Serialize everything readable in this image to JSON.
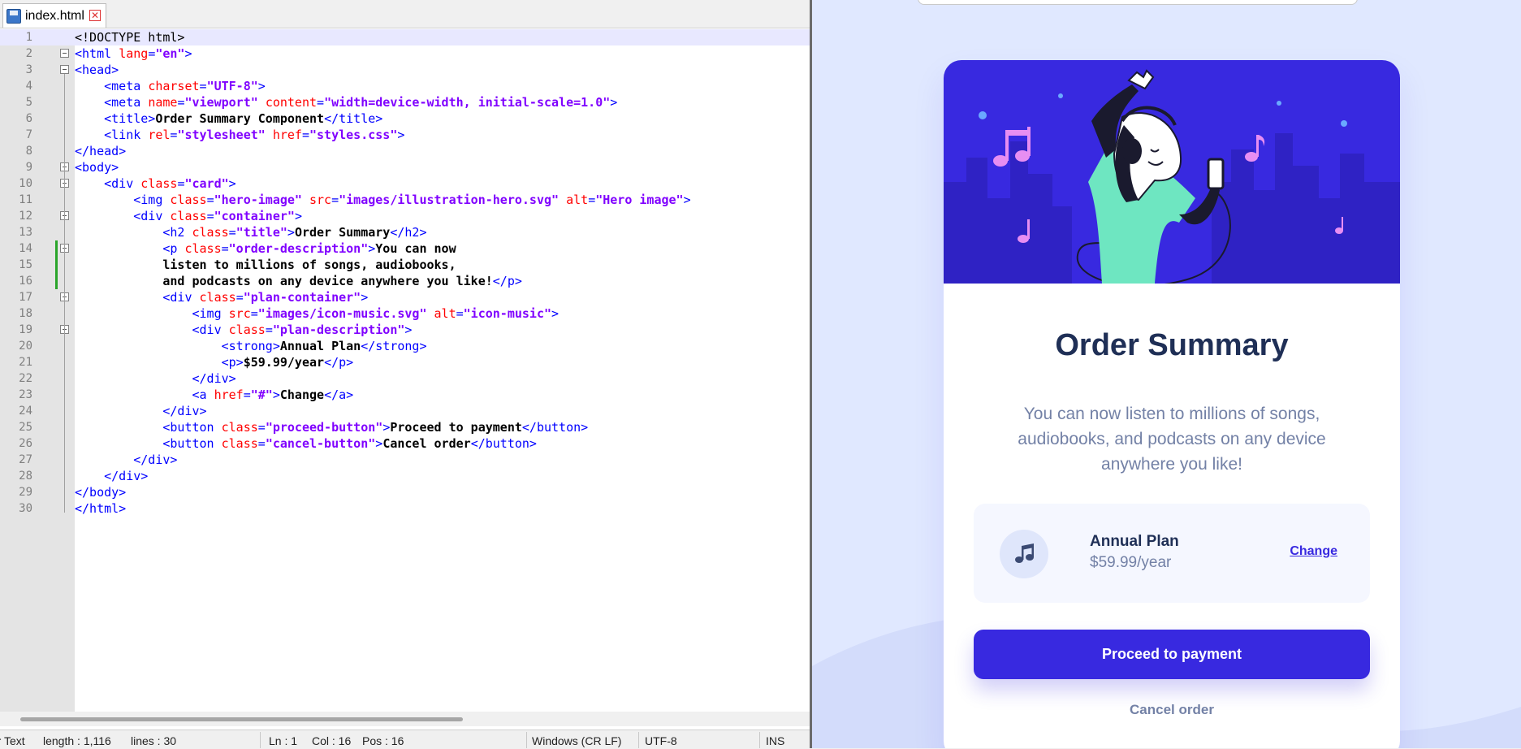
{
  "editor": {
    "tab_label": "index.html",
    "lines": [
      [
        {
          "c": "doc",
          "t": "<!DOCTYPE html>"
        }
      ],
      [
        {
          "c": "tag",
          "t": "<html "
        },
        {
          "c": "attr",
          "t": "lang"
        },
        {
          "c": "tag",
          "t": "="
        },
        {
          "c": "val",
          "t": "\"en\""
        },
        {
          "c": "tag",
          "t": ">"
        }
      ],
      [
        {
          "c": "tag",
          "t": "<head>"
        }
      ],
      [
        {
          "c": "doc",
          "t": "    "
        },
        {
          "c": "tag",
          "t": "<meta "
        },
        {
          "c": "attr",
          "t": "charset"
        },
        {
          "c": "tag",
          "t": "="
        },
        {
          "c": "val",
          "t": "\"UTF-8\""
        },
        {
          "c": "tag",
          "t": ">"
        }
      ],
      [
        {
          "c": "doc",
          "t": "    "
        },
        {
          "c": "tag",
          "t": "<meta "
        },
        {
          "c": "attr",
          "t": "name"
        },
        {
          "c": "tag",
          "t": "="
        },
        {
          "c": "val",
          "t": "\"viewport\""
        },
        {
          "c": "doc",
          "t": " "
        },
        {
          "c": "attr",
          "t": "content"
        },
        {
          "c": "tag",
          "t": "="
        },
        {
          "c": "val",
          "t": "\"width=device-width, initial-scale=1.0\""
        },
        {
          "c": "tag",
          "t": ">"
        }
      ],
      [
        {
          "c": "doc",
          "t": "    "
        },
        {
          "c": "tag",
          "t": "<title>"
        },
        {
          "c": "text",
          "t": "Order Summary Component"
        },
        {
          "c": "tag",
          "t": "</title>"
        }
      ],
      [
        {
          "c": "doc",
          "t": "    "
        },
        {
          "c": "tag",
          "t": "<link "
        },
        {
          "c": "attr",
          "t": "rel"
        },
        {
          "c": "tag",
          "t": "="
        },
        {
          "c": "val",
          "t": "\"stylesheet\""
        },
        {
          "c": "doc",
          "t": " "
        },
        {
          "c": "attr",
          "t": "href"
        },
        {
          "c": "tag",
          "t": "="
        },
        {
          "c": "val",
          "t": "\"styles.css\""
        },
        {
          "c": "tag",
          "t": ">"
        }
      ],
      [
        {
          "c": "tag",
          "t": "</head>"
        }
      ],
      [
        {
          "c": "tag",
          "t": "<body>"
        }
      ],
      [
        {
          "c": "doc",
          "t": "    "
        },
        {
          "c": "tag",
          "t": "<div "
        },
        {
          "c": "attr",
          "t": "class"
        },
        {
          "c": "tag",
          "t": "="
        },
        {
          "c": "val",
          "t": "\"card\""
        },
        {
          "c": "tag",
          "t": ">"
        }
      ],
      [
        {
          "c": "doc",
          "t": "        "
        },
        {
          "c": "tag",
          "t": "<img "
        },
        {
          "c": "attr",
          "t": "class"
        },
        {
          "c": "tag",
          "t": "="
        },
        {
          "c": "val",
          "t": "\"hero-image\""
        },
        {
          "c": "doc",
          "t": " "
        },
        {
          "c": "attr",
          "t": "src"
        },
        {
          "c": "tag",
          "t": "="
        },
        {
          "c": "val",
          "t": "\"images/illustration-hero.svg\""
        },
        {
          "c": "doc",
          "t": " "
        },
        {
          "c": "attr",
          "t": "alt"
        },
        {
          "c": "tag",
          "t": "="
        },
        {
          "c": "val",
          "t": "\"Hero image\""
        },
        {
          "c": "tag",
          "t": ">"
        }
      ],
      [
        {
          "c": "doc",
          "t": "        "
        },
        {
          "c": "tag",
          "t": "<div "
        },
        {
          "c": "attr",
          "t": "class"
        },
        {
          "c": "tag",
          "t": "="
        },
        {
          "c": "val",
          "t": "\"container\""
        },
        {
          "c": "tag",
          "t": ">"
        }
      ],
      [
        {
          "c": "doc",
          "t": "            "
        },
        {
          "c": "tag",
          "t": "<h2 "
        },
        {
          "c": "attr",
          "t": "class"
        },
        {
          "c": "tag",
          "t": "="
        },
        {
          "c": "val",
          "t": "\"title\""
        },
        {
          "c": "tag",
          "t": ">"
        },
        {
          "c": "text",
          "t": "Order Summary"
        },
        {
          "c": "tag",
          "t": "</h2>"
        }
      ],
      [
        {
          "c": "doc",
          "t": "            "
        },
        {
          "c": "tag",
          "t": "<p "
        },
        {
          "c": "attr",
          "t": "class"
        },
        {
          "c": "tag",
          "t": "="
        },
        {
          "c": "val",
          "t": "\"order-description\""
        },
        {
          "c": "tag",
          "t": ">"
        },
        {
          "c": "text",
          "t": "You can now"
        }
      ],
      [
        {
          "c": "text",
          "t": "            listen to millions of songs, audiobooks,"
        }
      ],
      [
        {
          "c": "text",
          "t": "            and podcasts on any device anywhere you like!"
        },
        {
          "c": "tag",
          "t": "</p>"
        }
      ],
      [
        {
          "c": "doc",
          "t": "            "
        },
        {
          "c": "tag",
          "t": "<div "
        },
        {
          "c": "attr",
          "t": "class"
        },
        {
          "c": "tag",
          "t": "="
        },
        {
          "c": "val",
          "t": "\"plan-container\""
        },
        {
          "c": "tag",
          "t": ">"
        }
      ],
      [
        {
          "c": "doc",
          "t": "                "
        },
        {
          "c": "tag",
          "t": "<img "
        },
        {
          "c": "attr",
          "t": "src"
        },
        {
          "c": "tag",
          "t": "="
        },
        {
          "c": "val",
          "t": "\"images/icon-music.svg\""
        },
        {
          "c": "doc",
          "t": " "
        },
        {
          "c": "attr",
          "t": "alt"
        },
        {
          "c": "tag",
          "t": "="
        },
        {
          "c": "val",
          "t": "\"icon-music\""
        },
        {
          "c": "tag",
          "t": ">"
        }
      ],
      [
        {
          "c": "doc",
          "t": "                "
        },
        {
          "c": "tag",
          "t": "<div "
        },
        {
          "c": "attr",
          "t": "class"
        },
        {
          "c": "tag",
          "t": "="
        },
        {
          "c": "val",
          "t": "\"plan-description\""
        },
        {
          "c": "tag",
          "t": ">"
        }
      ],
      [
        {
          "c": "doc",
          "t": "                    "
        },
        {
          "c": "tag",
          "t": "<strong>"
        },
        {
          "c": "text",
          "t": "Annual Plan"
        },
        {
          "c": "tag",
          "t": "</strong>"
        }
      ],
      [
        {
          "c": "doc",
          "t": "                    "
        },
        {
          "c": "tag",
          "t": "<p>"
        },
        {
          "c": "text",
          "t": "$59.99/year"
        },
        {
          "c": "tag",
          "t": "</p>"
        }
      ],
      [
        {
          "c": "doc",
          "t": "                "
        },
        {
          "c": "tag",
          "t": "</div>"
        }
      ],
      [
        {
          "c": "doc",
          "t": "                "
        },
        {
          "c": "tag",
          "t": "<a "
        },
        {
          "c": "attr",
          "t": "href"
        },
        {
          "c": "tag",
          "t": "="
        },
        {
          "c": "val",
          "t": "\"#\""
        },
        {
          "c": "tag",
          "t": ">"
        },
        {
          "c": "text",
          "t": "Change"
        },
        {
          "c": "tag",
          "t": "</a>"
        }
      ],
      [
        {
          "c": "doc",
          "t": "            "
        },
        {
          "c": "tag",
          "t": "</div>"
        }
      ],
      [
        {
          "c": "doc",
          "t": "            "
        },
        {
          "c": "tag",
          "t": "<button "
        },
        {
          "c": "attr",
          "t": "class"
        },
        {
          "c": "tag",
          "t": "="
        },
        {
          "c": "val",
          "t": "\"proceed-button\""
        },
        {
          "c": "tag",
          "t": ">"
        },
        {
          "c": "text",
          "t": "Proceed to payment"
        },
        {
          "c": "tag",
          "t": "</button>"
        }
      ],
      [
        {
          "c": "doc",
          "t": "            "
        },
        {
          "c": "tag",
          "t": "<button "
        },
        {
          "c": "attr",
          "t": "class"
        },
        {
          "c": "tag",
          "t": "="
        },
        {
          "c": "val",
          "t": "\"cancel-button\""
        },
        {
          "c": "tag",
          "t": ">"
        },
        {
          "c": "text",
          "t": "Cancel order"
        },
        {
          "c": "tag",
          "t": "</button>"
        }
      ],
      [
        {
          "c": "doc",
          "t": "        "
        },
        {
          "c": "tag",
          "t": "</div>"
        }
      ],
      [
        {
          "c": "doc",
          "t": "    "
        },
        {
          "c": "tag",
          "t": "</div>"
        }
      ],
      [
        {
          "c": "tag",
          "t": "</body>"
        }
      ],
      [
        {
          "c": "tag",
          "t": "</html>"
        }
      ]
    ],
    "fold_lines": [
      2,
      3,
      9,
      10,
      12,
      14,
      17,
      19
    ],
    "current_line": 1,
    "changed_lines": [
      14,
      15,
      16
    ]
  },
  "statusbar": {
    "type": "Hyper Text",
    "length": "length : 1,116",
    "lines": "lines : 30",
    "ln": "Ln : 1",
    "col": "Col : 16",
    "pos": "Pos : 16",
    "eol": "Windows (CR LF)",
    "encoding": "UTF-8",
    "mode": "INS"
  },
  "preview": {
    "title": "Order Summary",
    "description": "You can now listen to millions of songs, audiobooks, and podcasts on any device anywhere you like!",
    "plan_name": "Annual Plan",
    "plan_price": "$59.99/year",
    "change_label": "Change",
    "proceed_label": "Proceed to payment",
    "cancel_label": "Cancel order",
    "hero_alt": "Hero image",
    "icons": {
      "music": "music-icon"
    }
  },
  "colors": {
    "accent": "#3829e0",
    "title": "#1f2f56",
    "muted": "#7381a6",
    "page_bg": "#e0e8ff",
    "plan_bg": "#f5f7ff",
    "hero_bg": "#3829e0",
    "hero_teal": "#6ee6c1",
    "note_pink": "#e78ef2"
  }
}
